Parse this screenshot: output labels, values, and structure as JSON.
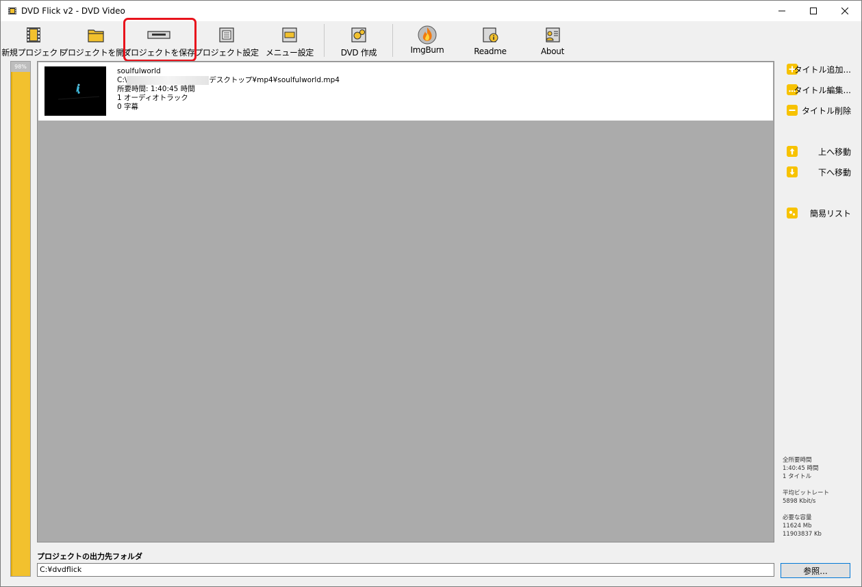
{
  "window": {
    "title": "DVD Flick v2 - DVD Video"
  },
  "toolbar": {
    "buttons": [
      {
        "label": "新規プロジェクト",
        "icon": "film-new-icon"
      },
      {
        "label": "プロジェクトを開く",
        "icon": "folder-open-icon"
      },
      {
        "label": "プロジェクトを保存",
        "icon": "save-drive-icon"
      },
      {
        "label": "プロジェクト設定",
        "icon": "project-settings-icon"
      },
      {
        "label": "メニュー設定",
        "icon": "menu-settings-icon"
      },
      {
        "label": "DVD 作成",
        "icon": "dvd-create-gear-icon"
      },
      {
        "label": "ImgBurn",
        "icon": "imgburn-flame-icon"
      },
      {
        "label": "Readme",
        "icon": "readme-info-icon"
      },
      {
        "label": "About",
        "icon": "about-user-icon"
      }
    ],
    "highlighted": "プロジェクトを保存",
    "highlight_color": "#e8131c"
  },
  "progress": {
    "label": "98%",
    "value": 0.98,
    "color": "#f2c12e"
  },
  "titles": [
    {
      "name": "soulfulworld",
      "path_prefix": "C:\\",
      "path_suffix": "デスクトップ¥mp4¥soulfulworld.mp4",
      "duration": "所要時間: 1:40:45 時間",
      "audio_tracks": "1 オーディオトラック",
      "subtitles": "0 字幕"
    }
  ],
  "side_buttons": [
    {
      "label": "タイトル追加...",
      "icon": "plus-icon"
    },
    {
      "label": "タイトル編集...",
      "icon": "ellipsis-icon"
    },
    {
      "label": "タイトル削除",
      "icon": "minus-icon"
    },
    {
      "label": "上へ移動",
      "icon": "arrow-up-icon"
    },
    {
      "label": "下へ移動",
      "icon": "arrow-down-icon"
    },
    {
      "label": "簡易リスト",
      "icon": "list-icon"
    }
  ],
  "stats": {
    "total_time_label": "全所要時間",
    "total_time": "1:40:45 時間",
    "title_count": "1 タイトル",
    "bitrate_label": "平均ビットレート",
    "bitrate": "5898 Kbit/s",
    "size_label": "必要な容量",
    "size_mb": "11624 Mb",
    "size_kb": "11903837 Kb"
  },
  "output": {
    "label": "プロジェクトの出力先フォルダ",
    "path": "C:¥dvdflick",
    "browse_label": "参照..."
  }
}
